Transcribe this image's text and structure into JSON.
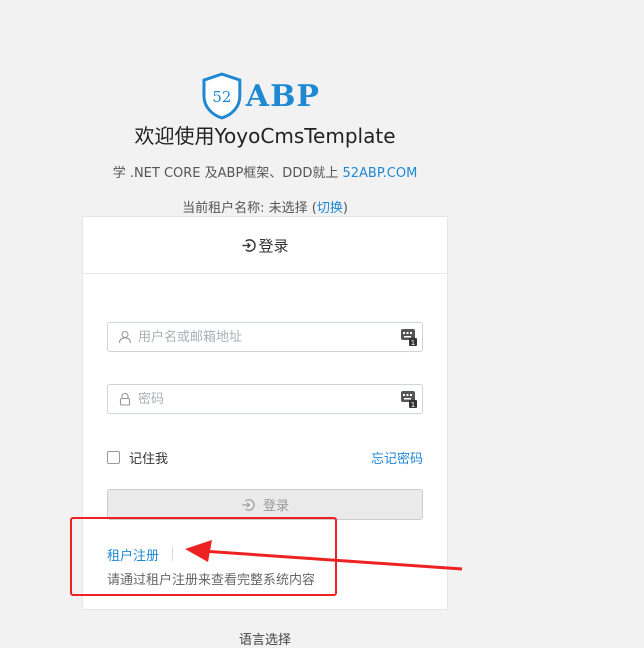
{
  "logo": {
    "badge_text": "52",
    "text": "ABP"
  },
  "welcome_title": "欢迎使用YoyoCmsTemplate",
  "subtitle": {
    "prefix": "学 .NET CORE 及ABP框架、DDD就上 ",
    "link": "52ABP.COM"
  },
  "tenant": {
    "prefix": "当前租户名称: 未选择 (",
    "switch_link": "切换",
    "suffix": ")"
  },
  "login_form": {
    "header": "登录",
    "username_placeholder": "用户名或邮箱地址",
    "password_placeholder": "密码",
    "remember_me": "记住我",
    "forgot_password": "忘记密码",
    "submit_label": "登录",
    "register_link": "租户注册",
    "register_hint": "请通过租户注册来查看完整系统内容"
  },
  "language_selector": "语言选择",
  "colors": {
    "accent": "#1e88d3",
    "annotation": "#ee2222"
  },
  "icons": {
    "logo": "shield-logo-icon",
    "header": "login-icon",
    "username": "user-icon",
    "password": "lock-icon",
    "password_manager": "keyboard-icon"
  }
}
